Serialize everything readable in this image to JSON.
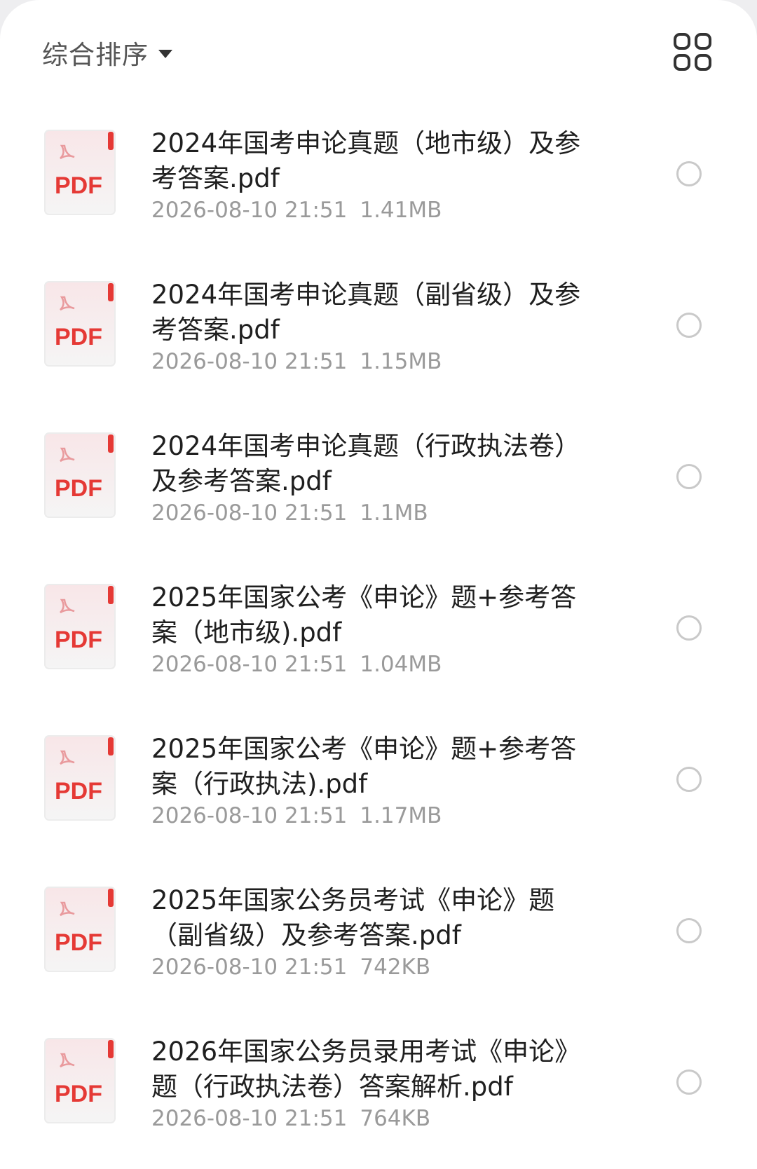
{
  "toolbar": {
    "sort_label": "综合排序",
    "sort_caret_icon": "caret-down-icon",
    "view_toggle_icon": "grid-view-icon"
  },
  "colors": {
    "pdf_red": "#e53935",
    "pdf_bg": "#f6f1f2",
    "title_text": "#1f1f1f",
    "meta_text": "#9a9a9a"
  },
  "files": [
    {
      "icon_label": "PDF",
      "name": "2024年国考申论真题（地市级）及参考答案.pdf",
      "date": "2026-08-10 21:51",
      "size": "1.41MB"
    },
    {
      "icon_label": "PDF",
      "name": "2024年国考申论真题（副省级）及参考答案.pdf",
      "date": "2026-08-10 21:51",
      "size": "1.15MB"
    },
    {
      "icon_label": "PDF",
      "name": "2024年国考申论真题（行政执法卷）及参考答案.pdf",
      "date": "2026-08-10 21:51",
      "size": "1.1MB"
    },
    {
      "icon_label": "PDF",
      "name": "2025年国家公考《申论》题+参考答案（地市级).pdf",
      "date": "2026-08-10 21:51",
      "size": "1.04MB"
    },
    {
      "icon_label": "PDF",
      "name": "2025年国家公考《申论》题+参考答案（行政执法).pdf",
      "date": "2026-08-10 21:51",
      "size": "1.17MB"
    },
    {
      "icon_label": "PDF",
      "name": "2025年国家公务员考试《申论》题（副省级）及参考答案.pdf",
      "date": "2026-08-10 21:51",
      "size": "742KB"
    },
    {
      "icon_label": "PDF",
      "name": "2026年国家公务员录用考试《申论》题（行政执法卷）答案解析.pdf",
      "date": "2026-08-10 21:51",
      "size": "764KB"
    }
  ]
}
